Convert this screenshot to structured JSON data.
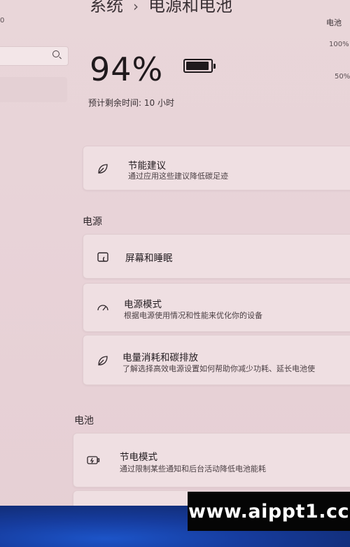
{
  "header": {
    "breadcrumb_root": "系统",
    "breadcrumb_sep": "›",
    "breadcrumb_page": "电源和电池",
    "right_label": "电池",
    "left_label": "0",
    "chart_pct_high": "100%",
    "chart_pct_mid": "50%"
  },
  "battery": {
    "percent_text": "94%",
    "level": 0.94,
    "remaining_text": "预计剩余时间: 10 小时"
  },
  "cards": {
    "energy_saving_suggestions": {
      "title": "节能建议",
      "subtitle": "通过应用这些建议降低碳足迹",
      "icon": "leaf-icon"
    }
  },
  "sections": {
    "power": {
      "label": "电源",
      "items": [
        {
          "title": "屏幕和睡眠",
          "subtitle": "",
          "icon": "screen-sleep-icon"
        },
        {
          "title": "电源模式",
          "subtitle": "根据电源使用情况和性能来优化你的设备",
          "icon": "gauge-icon"
        },
        {
          "title": "电量消耗和碳排放",
          "subtitle": "了解选择高效电源设置如何帮助你减少功耗、延长电池使",
          "icon": "leaf-icon"
        }
      ]
    },
    "battery": {
      "label": "电池",
      "items": [
        {
          "title": "节电模式",
          "subtitle": "通过限制某些通知和后台活动降低电池能耗",
          "icon": "battery-saver-icon"
        }
      ]
    }
  },
  "watermark": {
    "text": "www.aippt1.cc"
  },
  "colors": {
    "background": "#e9d6d9",
    "card": "#efdfe2",
    "text": "#231c20",
    "taskbar": "#163c9e"
  }
}
